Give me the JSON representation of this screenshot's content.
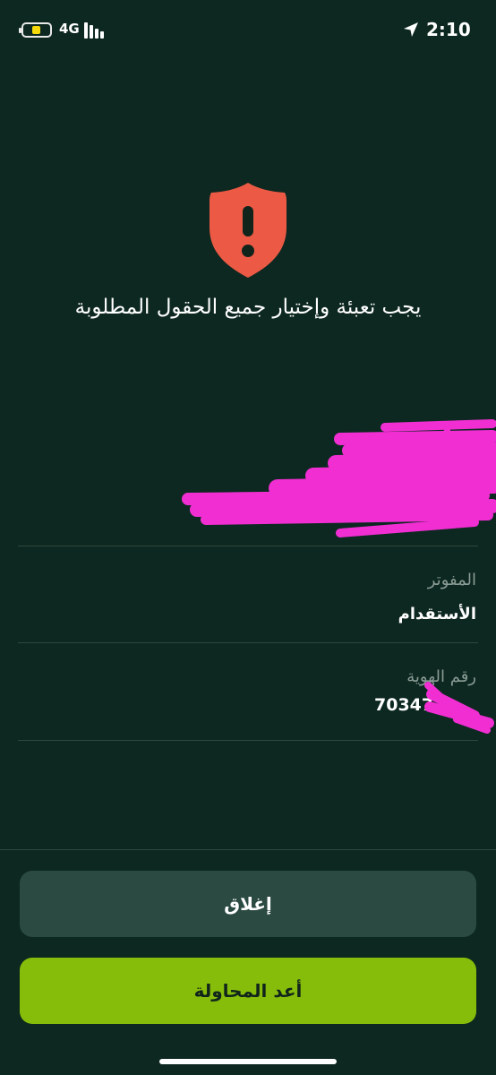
{
  "status_bar": {
    "network": "4G",
    "time": "2:10",
    "colors": {
      "battery_level": "#f5d90a"
    },
    "icons": [
      "battery-icon",
      "signal-icon",
      "location-arrow-icon"
    ]
  },
  "alert": {
    "icon": "shield-exclamation-icon",
    "icon_color": "#ec5a45",
    "message": "يجب تعبئة وإختيار جميع الحقول المطلوبة"
  },
  "fields": [
    {
      "label": "المفوتر",
      "value": "الأستقدام"
    },
    {
      "label": "رقم الهوية",
      "value": "70347"
    }
  ],
  "buttons": {
    "close_label": "إغلاق",
    "retry_label": "أعد المحاولة"
  },
  "colors": {
    "background": "#0d2820",
    "accent": "#86bd0a",
    "secondary_button": "#2b4a42",
    "redaction": "#f02ed2"
  }
}
